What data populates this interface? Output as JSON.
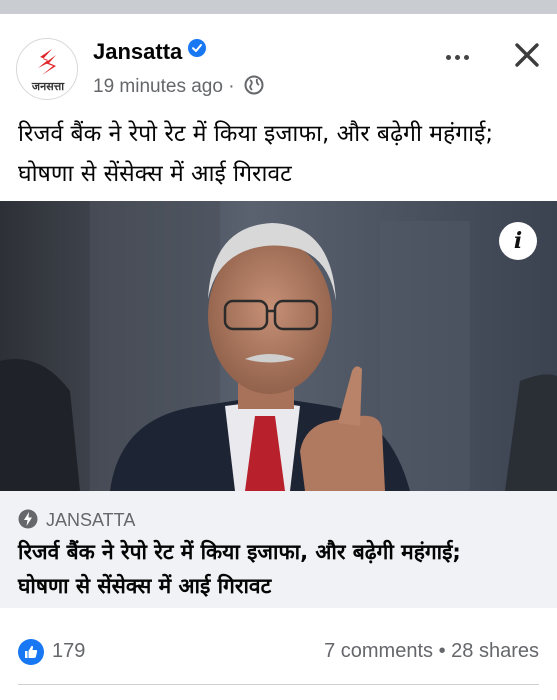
{
  "post": {
    "page_name": "Jansatta",
    "logo_text": "जनसत्ता",
    "time": "19 minutes ago",
    "meta_separator": "·",
    "text_line1": "रिजर्व बैंक ने रेपो रेट में किया इजाफा, और बढ़ेगी महंगाई;",
    "text_line2": "घोषणा से सेंसेक्स में आई गिरावट"
  },
  "link_preview": {
    "source": "JANSATTA",
    "title_line1": "रिजर्व बैंक ने रेपो रेट में किया इजाफा, और बढ़ेगी महंगाई;",
    "title_line2": "घोषणा से सेंसेक्स में आई गिरावट"
  },
  "stats": {
    "likes": "179",
    "comments": "7 comments",
    "separator": "•",
    "shares": "28 shares"
  },
  "icons": {
    "verified": "verified-badge-icon",
    "globe": "globe-icon",
    "more": "more-options-icon",
    "close": "close-icon",
    "info": "info-icon",
    "source": "bolt-icon",
    "like": "like-icon"
  },
  "colors": {
    "brand_blue": "#1877f2",
    "logo_red": "#e0252a",
    "secondary_text": "#65676b",
    "card_bg": "#f0f2f5"
  }
}
